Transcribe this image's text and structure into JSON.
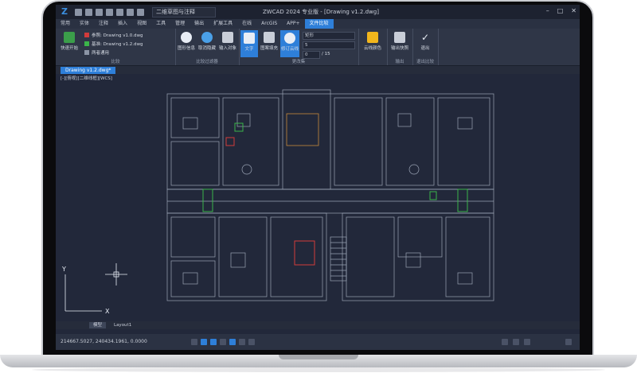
{
  "titlebar": {
    "title": "ZWCAD 2024 专业版 - [Drawing v1.2.dwg]",
    "workspace": "二维草图与注释",
    "logo": "zwcad-logo"
  },
  "menubar": {
    "items": [
      "常用",
      "实体",
      "注释",
      "插入",
      "视图",
      "工具",
      "管理",
      "输出",
      "扩展工具",
      "在线",
      "ArcGIS",
      "APP+",
      "文件比较"
    ],
    "active": "文件比较"
  },
  "ribbon": {
    "compare_button": "快速开始",
    "file_ref": "参照: Drawing v1.0.dwg",
    "file_new": "基准: Drawing v1.2.dwg",
    "file_both": "两者通用",
    "group_compare": "比较",
    "btn_info": "图形信息",
    "btn_cancel": "取消隐藏",
    "btn_import": "输入对象",
    "group_filter": "比较过滤器",
    "btn_text": "文字",
    "btn_hatch": "图案填充",
    "btn_cloud": "修订云线",
    "rect_label": "矩形",
    "rect_value": "5",
    "nav_value": "0",
    "nav_total": "/ 15",
    "group_change": "更改集",
    "btn_color": "云线颜色",
    "btn_snapshot": "输出快照",
    "btn_exit": "退出",
    "group_output": "输出",
    "group_exit": "退出比较",
    "accent": "#2e7fd9"
  },
  "doctab": {
    "label": "Drawing v1.2.dwg*",
    "view_label": "[-][俯视][二维线框][WCS]"
  },
  "axes": {
    "x": "X",
    "y": "Y"
  },
  "layout_tabs": [
    "模型",
    "Layout1"
  ],
  "statusbar": {
    "coords": "214667.5027, 240434.1961, 0.0000"
  }
}
